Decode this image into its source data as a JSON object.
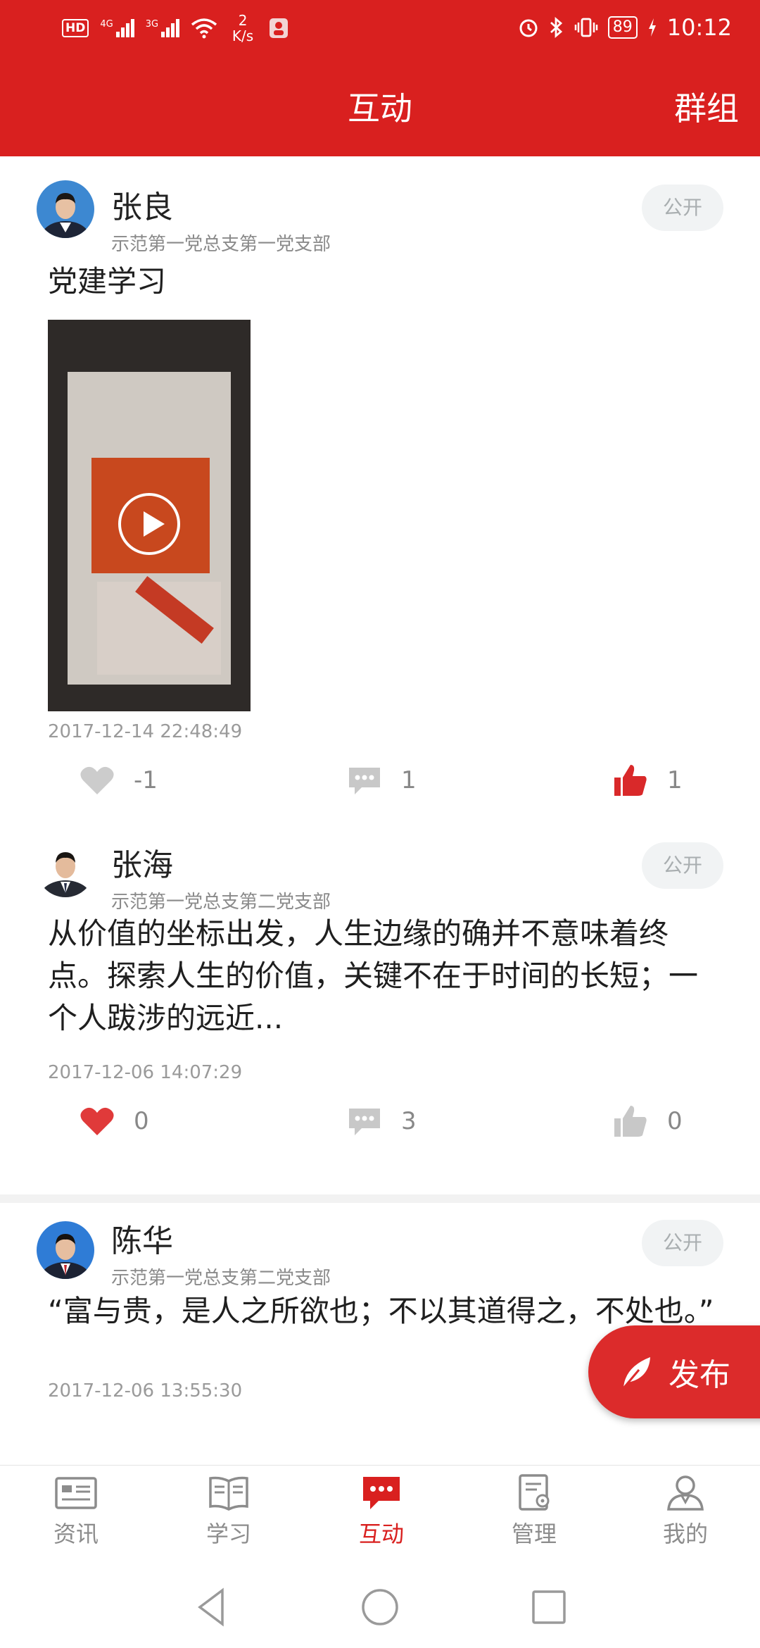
{
  "status_bar": {
    "left_badge": "HD",
    "signal_1_label": "4G",
    "signal_2_label": "3G",
    "speed_value": "2",
    "speed_unit": "K/s",
    "battery": "89",
    "time": "10:12"
  },
  "header": {
    "title": "互动",
    "right_action": "群组"
  },
  "posts": [
    {
      "author": "张良",
      "branch": "示范第一党总支第一党支部",
      "visibility": "公开",
      "text": "党建学习",
      "has_video": true,
      "time": "2017-12-14 22:48:49",
      "likes": "-1",
      "comments": "1",
      "thumbs": "1",
      "liked": false,
      "thumbed": true
    },
    {
      "author": "张海",
      "branch": "示范第一党总支第二党支部",
      "visibility": "公开",
      "text": "从价值的坐标出发，人生边缘的确并不意味着终点。探索人生的价值，关键不在于时间的长短；一个人跋涉的远近...",
      "has_video": false,
      "time": "2017-12-06 14:07:29",
      "likes": "0",
      "comments": "3",
      "thumbs": "0",
      "liked": true,
      "thumbed": false
    },
    {
      "author": "陈华",
      "branch": "示范第一党总支第二党支部",
      "visibility": "公开",
      "text": "“富与贵，是人之所欲也；不以其道得之，不处也。”",
      "has_video": false,
      "time": "2017-12-06 13:55:30"
    }
  ],
  "fab": {
    "label": "发布",
    "icon": "feather-icon"
  },
  "tabs": [
    {
      "label": "资讯",
      "icon": "news-icon",
      "active": false
    },
    {
      "label": "学习",
      "icon": "book-icon",
      "active": false
    },
    {
      "label": "互动",
      "icon": "chat-icon",
      "active": true
    },
    {
      "label": "管理",
      "icon": "manage-icon",
      "active": false
    },
    {
      "label": "我的",
      "icon": "profile-icon",
      "active": false
    }
  ],
  "colors": {
    "brand_red": "#d9201f",
    "like_red": "#e03a3a",
    "inactive_icon": "#c8c8c8",
    "muted_text": "#9a9a9a"
  }
}
